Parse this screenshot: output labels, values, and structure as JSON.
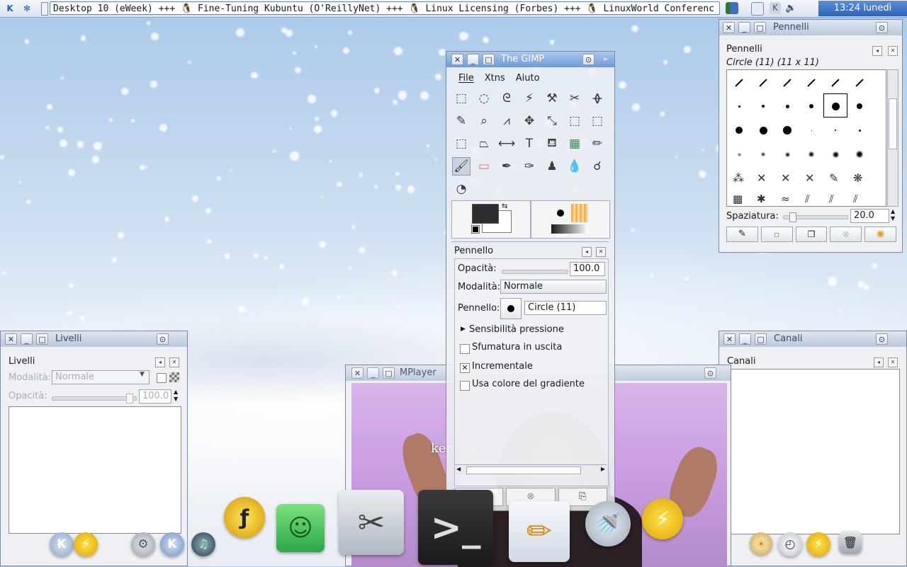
{
  "topbar": {
    "ticker": "Desktop 10 (eWeek) +++ 🐧 Fine-Tuning Kubuntu (O'ReillyNet) +++ 🐧 Linux Licensing (Forbes) +++ 🐧 LinuxWorld Conferenc",
    "clock": "13:24 lunedì",
    "icons": [
      "k-menu-icon",
      "snowflake-icon",
      "pager-icon",
      "desktop-icon",
      "kde-icon",
      "volume-icon"
    ]
  },
  "pennelli_win": {
    "title": "Pennelli",
    "panel_title": "Pennelli",
    "selected": "Circle (11) (11 x 11)",
    "spacing_label": "Spaziatura:",
    "spacing_value": "20.0"
  },
  "gimp_win": {
    "title": "The GIMP",
    "menu": [
      "File",
      "Xtns",
      "Aiuto"
    ],
    "tool_options": {
      "title": "Pennello",
      "opacity_label": "Opacità:",
      "opacity_value": "100.0",
      "mode_label": "Modalità:",
      "mode_value": "Normale",
      "brush_label": "Pennello:",
      "brush_value": "Circle (11)",
      "pressure_label": "Sensibilità pressione",
      "fade_label": "Sfumatura in uscita",
      "fade_checked": false,
      "incremental_label": "Incrementale",
      "incremental_checked": true,
      "gradient_label": "Usa colore del gradiente",
      "gradient_checked": false
    }
  },
  "livelli_win": {
    "title": "Livelli",
    "panel_title": "Livelli",
    "mode_label": "Modalità:",
    "mode_value": "Normale",
    "opacity_label": "Opacità:",
    "opacity_value": "100.0"
  },
  "canali_win": {
    "title": "Canali",
    "panel_title": "Canali"
  },
  "mplayer_win": {
    "title": "MPlayer",
    "video_caption": "kenneth"
  },
  "colors": {
    "accent": "#6f9ad6",
    "sky": "#a9c9ea",
    "video": "#cfa6e2"
  }
}
